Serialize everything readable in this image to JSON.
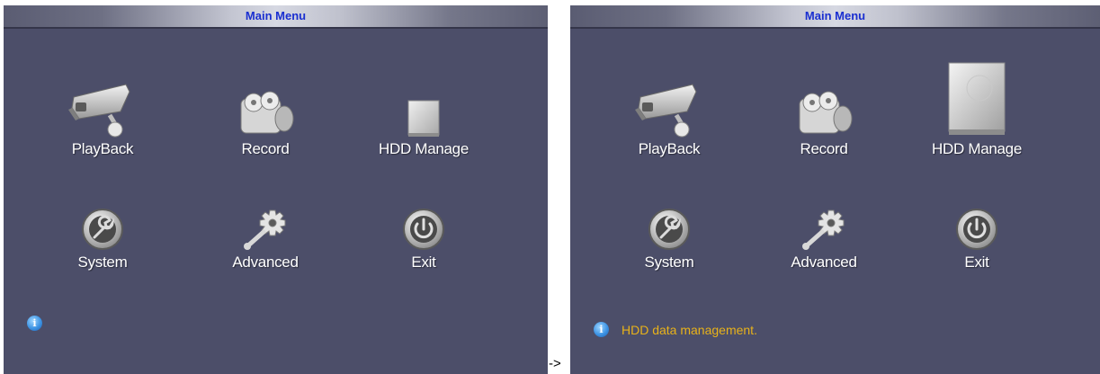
{
  "left_panel": {
    "title": "Main Menu",
    "items": [
      {
        "label": "PlayBack",
        "icon": "camera-icon"
      },
      {
        "label": "Record",
        "icon": "record-icon"
      },
      {
        "label": "HDD Manage",
        "icon": "hdd-icon"
      },
      {
        "label": "System",
        "icon": "wrench-icon"
      },
      {
        "label": "Advanced",
        "icon": "gear-wrench-icon"
      },
      {
        "label": "Exit",
        "icon": "power-icon"
      }
    ],
    "status_text": ""
  },
  "arrow": "->",
  "right_panel": {
    "title": "Main Menu",
    "items": [
      {
        "label": "PlayBack",
        "icon": "camera-icon"
      },
      {
        "label": "Record",
        "icon": "record-icon"
      },
      {
        "label": "HDD Manage",
        "icon": "hdd-icon",
        "selected": true
      },
      {
        "label": "System",
        "icon": "wrench-icon"
      },
      {
        "label": "Advanced",
        "icon": "gear-wrench-icon"
      },
      {
        "label": "Exit",
        "icon": "power-icon"
      }
    ],
    "status_text": "HDD data management."
  },
  "colors": {
    "panel_bg": "#4c4e69",
    "title_text": "#1a2fd0",
    "status_text": "#e8b21a"
  }
}
